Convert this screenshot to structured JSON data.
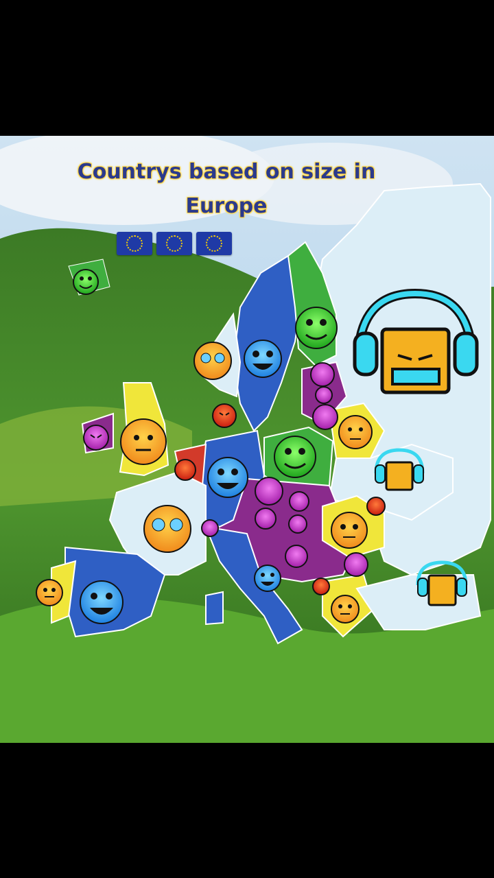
{
  "title": "Countrys based on size in Europe",
  "flags": [
    {
      "icon": "eu-flag-icon"
    },
    {
      "icon": "eu-flag-icon"
    },
    {
      "icon": "eu-flag-icon"
    }
  ],
  "colors": {
    "easy": "#3fae3f",
    "normal": "#2f5fc4",
    "hard": "#f0e63a",
    "harder": "#d23a2a",
    "insane": "#8a2b8c",
    "demon": "#dceef7",
    "sea": "#e8f3f8"
  }
}
